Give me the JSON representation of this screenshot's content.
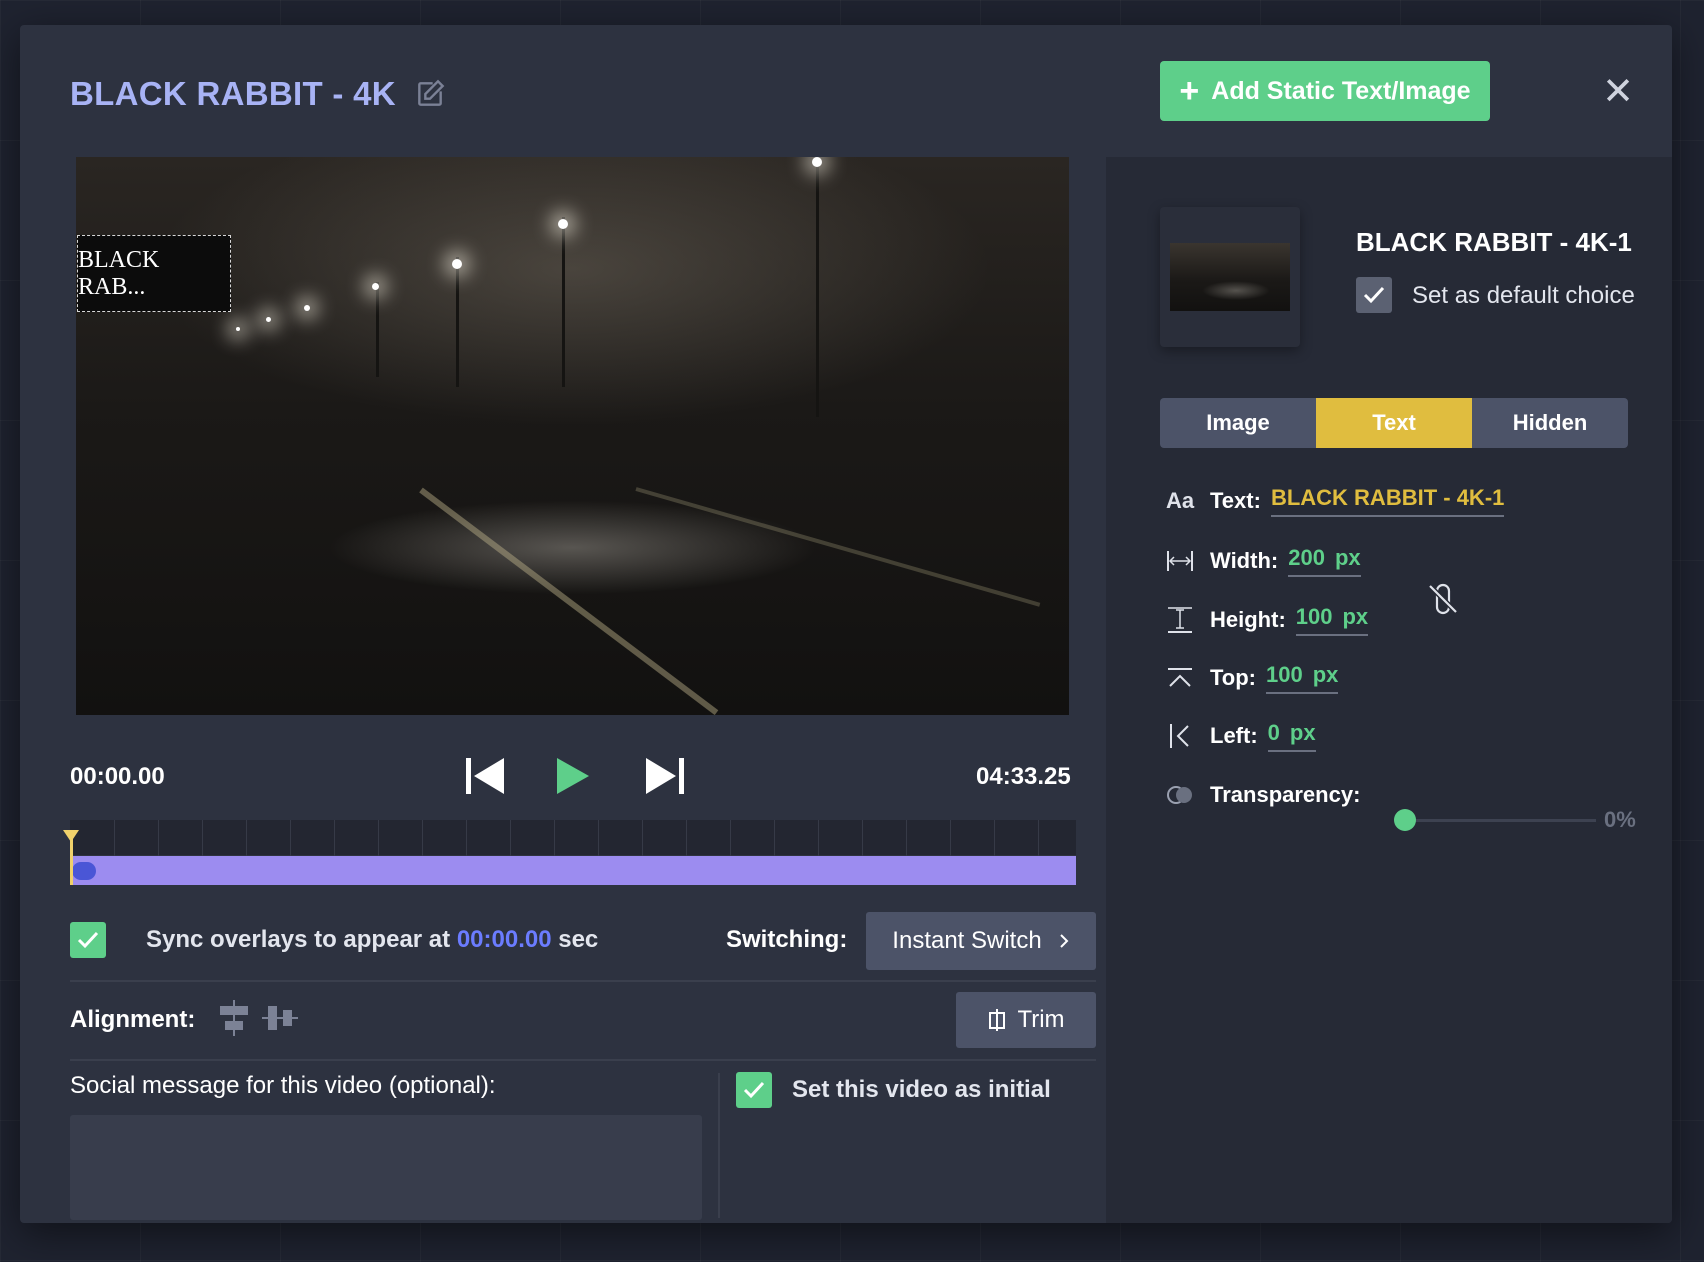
{
  "header": {
    "title": "BLACK RABBIT - 4K",
    "add_button_label": "Add Static Text/Image",
    "close_symbol": "✕"
  },
  "video": {
    "overlay_text": "BLACK RAB..."
  },
  "player": {
    "current_time": "00:00.00",
    "total_time": "04:33.25"
  },
  "sync": {
    "label_prefix": "Sync overlays to appear at",
    "time": "00:00.00",
    "label_suffix": "sec",
    "checked": true
  },
  "switching": {
    "label": "Switching:",
    "value": "Instant Switch"
  },
  "alignment": {
    "label": "Alignment:"
  },
  "trim": {
    "label": "Trim"
  },
  "social": {
    "label": "Social message for this video (optional):",
    "value": "",
    "placeholder": ""
  },
  "initial": {
    "label": "Set this video as initial",
    "checked": true
  },
  "right_panel": {
    "clip_title": "BLACK RABBIT - 4K-1",
    "default_label": "Set as default choice",
    "default_checked": true,
    "tabs": [
      {
        "label": "Image",
        "active": false
      },
      {
        "label": "Text",
        "active": true
      },
      {
        "label": "Hidden",
        "active": false
      }
    ],
    "props": {
      "text": {
        "icon": "Aa",
        "label": "Text:",
        "value": "BLACK RABBIT - 4K-1"
      },
      "width": {
        "label": "Width:",
        "value": "200",
        "unit": "px"
      },
      "height": {
        "label": "Height:",
        "value": "100",
        "unit": "px"
      },
      "top": {
        "label": "Top:",
        "value": "100",
        "unit": "px"
      },
      "left": {
        "label": "Left:",
        "value": "0",
        "unit": "px"
      },
      "transparency": {
        "label": "Transparency:",
        "value": "0%"
      }
    }
  },
  "colors": {
    "accent_green": "#5ecf8a",
    "accent_yellow": "#e0bd3f",
    "accent_blue": "#6b7cff",
    "title_lavender": "#a8b3f5",
    "timeline_bar": "#9c8cf0"
  }
}
